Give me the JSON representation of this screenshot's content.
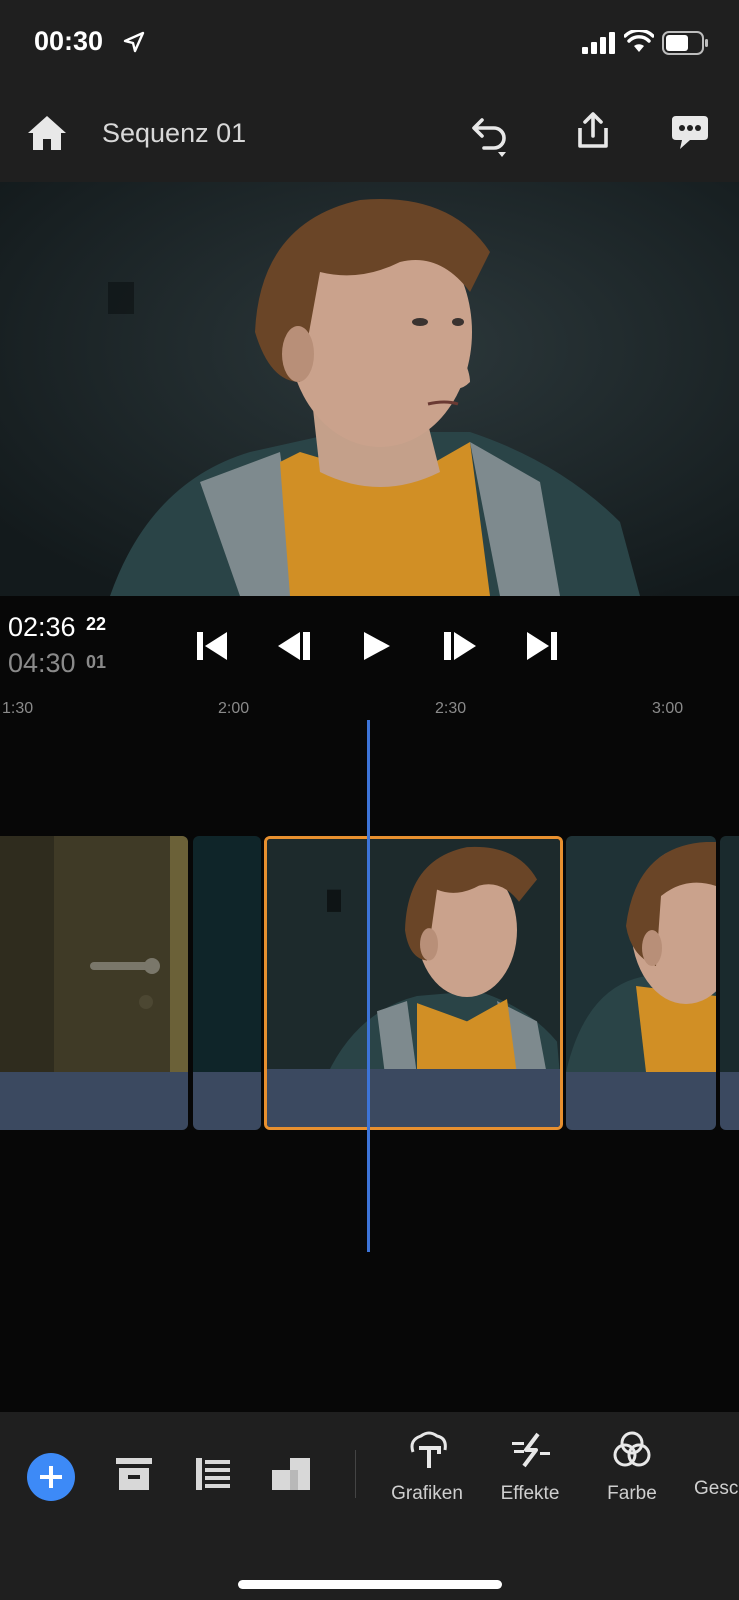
{
  "status_bar": {
    "time": "00:30"
  },
  "header": {
    "title": "Sequenz 01"
  },
  "transport": {
    "current_time": "02:36",
    "current_frames": "22",
    "total_time": "04:30",
    "total_frames": "01"
  },
  "ruler": {
    "labels": [
      "1:30",
      "2:00",
      "2:30",
      "3:00"
    ]
  },
  "toolbar": {
    "items": [
      {
        "label": "Grafiken",
        "icon": "graphics-icon"
      },
      {
        "label": "Effekte",
        "icon": "effects-icon"
      },
      {
        "label": "Farbe",
        "icon": "color-icon"
      },
      {
        "label": "Gesc",
        "icon": "speed-icon"
      }
    ]
  },
  "colors": {
    "accent": "#3d8af7",
    "playhead": "#3d74d8",
    "selection": "#e8902f",
    "audio_track": "#3b4960"
  }
}
